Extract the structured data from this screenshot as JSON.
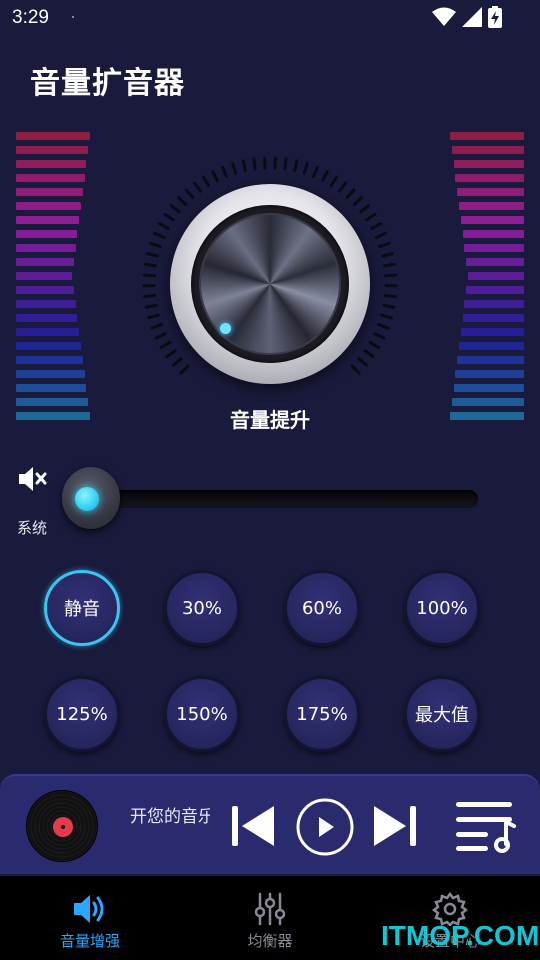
{
  "status_bar": {
    "time": "3:29"
  },
  "app": {
    "title": "音量扩音器"
  },
  "knob": {
    "label": "音量提升"
  },
  "slider": {
    "label": "系统",
    "value_fraction": 0.0
  },
  "presets": {
    "active_index": 0,
    "items": [
      {
        "label": "静音"
      },
      {
        "label": "30%"
      },
      {
        "label": "60%"
      },
      {
        "label": "100%"
      },
      {
        "label": "125%"
      },
      {
        "label": "150%"
      },
      {
        "label": "175%"
      },
      {
        "label": "最大值"
      }
    ]
  },
  "player": {
    "track_text": "开您的音乐"
  },
  "bottom_nav": {
    "items": [
      {
        "label": "音量增强",
        "icon": "speaker-icon",
        "active": true
      },
      {
        "label": "均衡器",
        "icon": "equalizer-icon",
        "active": false
      },
      {
        "label": "设置中心",
        "icon": "gear-icon",
        "active": false
      }
    ]
  },
  "watermark": {
    "text": "ITMOP.COM"
  },
  "colors": {
    "background": "#1a1a3c",
    "accent": "#39c6f2",
    "nav_active": "#2ea6ff",
    "player_bar": "#2a2a6e",
    "watermark": "#11c7d4"
  }
}
